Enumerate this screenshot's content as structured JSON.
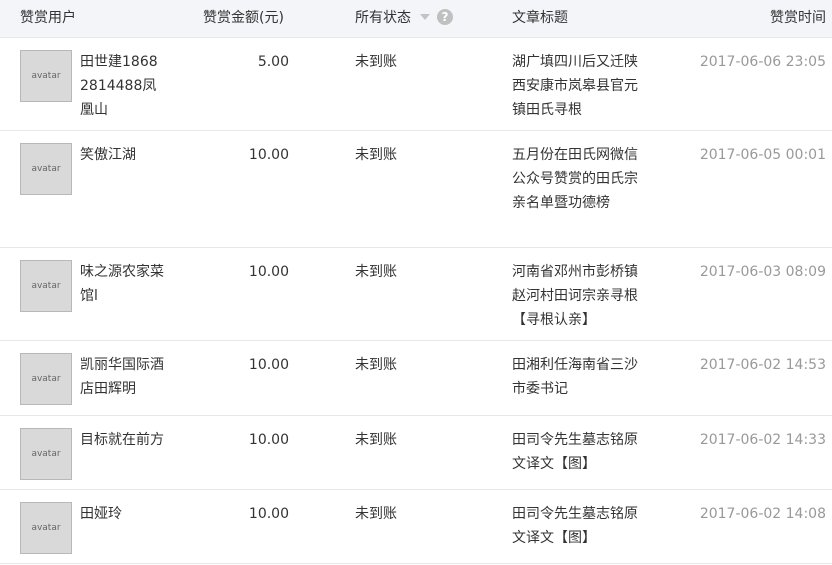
{
  "headers": {
    "user": "赞赏用户",
    "amount": "赞赏金额(元)",
    "status": "所有状态",
    "help": "?",
    "title": "文章标题",
    "time": "赞赏时间"
  },
  "rows": [
    {
      "name": "田世建18682814488凤凰山",
      "amount": "5.00",
      "status": "未到账",
      "title": "湖广填四川后又迁陕西安康市岚皋县官元镇田氏寻根",
      "time": "2017-06-06 23:05",
      "avatar": "avatar"
    },
    {
      "name": "笑傲江湖",
      "amount": "10.00",
      "status": "未到账",
      "title": "五月份在田氏网微信公众号赞赏的田氏宗亲名单暨功德榜",
      "time": "2017-06-05 00:01",
      "avatar": "avatar"
    },
    {
      "name": "味之源农家菜馆l",
      "amount": "10.00",
      "status": "未到账",
      "title": "河南省邓州市彭桥镇赵河村田诃宗亲寻根【寻根认亲】",
      "time": "2017-06-03 08:09",
      "avatar": "avatar"
    },
    {
      "name": "凯丽华国际酒店田辉明",
      "amount": "10.00",
      "status": "未到账",
      "title": "田湘利任海南省三沙市委书记",
      "time": "2017-06-02 14:53",
      "avatar": "avatar"
    },
    {
      "name": "目标就在前方",
      "amount": "10.00",
      "status": "未到账",
      "title": "田司令先生墓志铭原文译文【图】",
      "time": "2017-06-02 14:33",
      "avatar": "avatar"
    },
    {
      "name": "田娅玲",
      "amount": "10.00",
      "status": "未到账",
      "title": "田司令先生墓志铭原文译文【图】",
      "time": "2017-06-02 14:08",
      "avatar": "avatar"
    }
  ]
}
